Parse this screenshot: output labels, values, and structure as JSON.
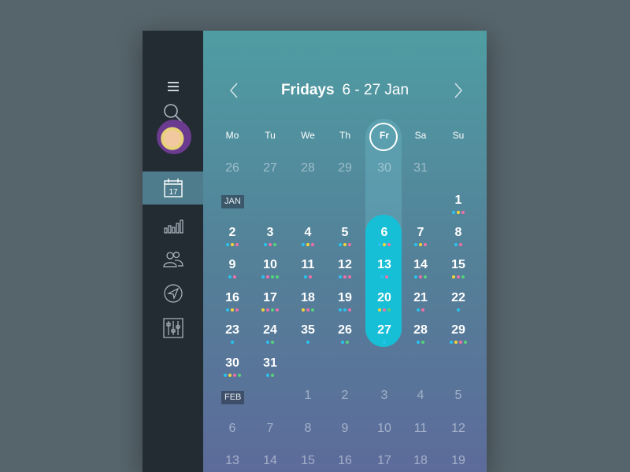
{
  "sidebar": {
    "items": [
      {
        "name": "menu-icon"
      },
      {
        "name": "search-icon"
      },
      {
        "name": "avatar"
      },
      {
        "name": "calendar-icon",
        "label": "17",
        "active": true
      },
      {
        "name": "bar-chart-icon"
      },
      {
        "name": "users-icon"
      },
      {
        "name": "navigation-icon"
      },
      {
        "name": "sliders-icon"
      }
    ]
  },
  "header": {
    "title_bold": "Fridays",
    "title_range": "6 - 27 Jan",
    "prev_icon": "chevron-left-icon",
    "next_icon": "chevron-right-icon"
  },
  "calendar": {
    "weekdays": [
      "Mo",
      "Tu",
      "We",
      "Th",
      "Fr",
      "Sa",
      "Su"
    ],
    "selected_weekday": "Fr",
    "month_tags": [
      "JAN",
      "FEB"
    ],
    "rows": [
      [
        "26",
        "27",
        "28",
        "29",
        "30",
        "31",
        ""
      ],
      [
        "",
        "",
        "",
        "",
        "",
        "",
        "1"
      ],
      [
        "2",
        "3",
        "4",
        "5",
        "6",
        "7",
        "8"
      ],
      [
        "9",
        "10",
        "11",
        "12",
        "13",
        "14",
        "15"
      ],
      [
        "16",
        "17",
        "18",
        "19",
        "20",
        "21",
        "22"
      ],
      [
        "23",
        "24",
        "35",
        "26",
        "27",
        "28",
        "29"
      ],
      [
        "30",
        "31",
        "",
        "",
        "",
        "",
        ""
      ],
      [
        "",
        "",
        "1",
        "2",
        "3",
        "4",
        "5"
      ],
      [
        "6",
        "7",
        "8",
        "9",
        "10",
        "11",
        "12"
      ],
      [
        "13",
        "14",
        "15",
        "16",
        "17",
        "18",
        "19"
      ]
    ]
  },
  "colors": {
    "dot_blue": "#29c3ee",
    "dot_yellow": "#f3d53b",
    "dot_pink": "#f06fa8",
    "dot_green": "#56d37a",
    "highlight": "#17bfd6",
    "sidebar_bg": "#232b33",
    "sidebar_active": "#4e7c8d"
  }
}
